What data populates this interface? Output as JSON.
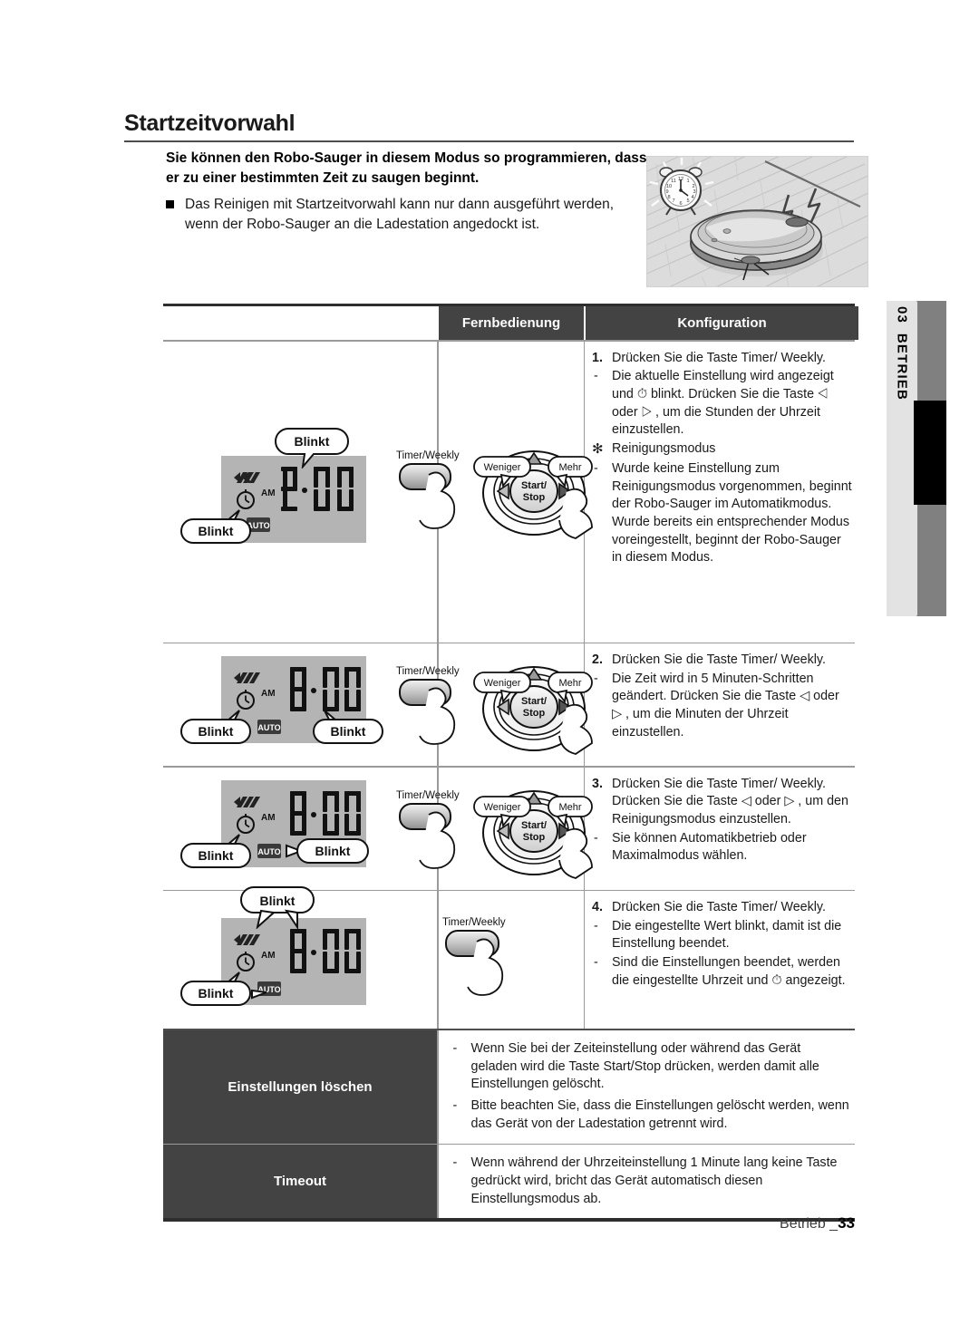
{
  "document": {
    "section_tab_number": "03",
    "section_tab_label": "BETRIEB",
    "heading": "Startzeitvorwahl",
    "footer_label": "Betrieb _",
    "footer_page": "33"
  },
  "intro": {
    "lead": "Sie können den Robo-Sauger in diesem Modus so programmieren, dass er zu einer bestimmten Zeit zu saugen beginnt.",
    "bullet": "Das Reinigen mit Startzeitvorwahl kann nur dann ausgeführt werden, wenn der Robo-Sauger an die Ladestation angedockt ist."
  },
  "hero_image": {
    "alt": "Robo-Sauger auf Holzboden mit Wecker",
    "clock_label": "12"
  },
  "table": {
    "headers": {
      "blank": "",
      "remote": "Fernbedienung",
      "config": "Konfiguration"
    },
    "rows": [
      {
        "display": {
          "time": "12:00",
          "meridiem": "AM",
          "auto_label": "AUTO",
          "callouts": [
            "Blinkt",
            "Blinkt"
          ]
        },
        "remote": {
          "timer_label": "Timer/Weekly",
          "less_label": "Weniger",
          "more_label": "Mehr",
          "center_label_1": "Start/",
          "center_label_2": "Stop",
          "show_dpad": true
        },
        "config": [
          {
            "marker": "1.",
            "text": "Drücken Sie die Taste Timer/ Weekly."
          },
          {
            "marker": "-",
            "text": "Die aktuelle Einstellung wird angezeigt und ⏱ blinkt. Drücken Sie die Taste ◁ oder ▷ , um die Stunden der Uhrzeit einzustellen."
          },
          {
            "marker": "✻",
            "text": "Reinigungsmodus"
          },
          {
            "marker": "-",
            "text": "Wurde keine Einstellung zum Reinigungsmodus vorgenommen, beginnt der Robo-Sauger im Automatikmodus. Wurde bereits ein entsprechender Modus voreingestellt, beginnt der Robo-Sauger in diesem Modus."
          }
        ]
      },
      {
        "display": {
          "time": "8:00",
          "meridiem": "AM",
          "auto_label": "AUTO",
          "callouts": [
            "Blinkt",
            "Blinkt"
          ]
        },
        "remote": {
          "timer_label": "Timer/Weekly",
          "less_label": "Weniger",
          "more_label": "Mehr",
          "center_label_1": "Start/",
          "center_label_2": "Stop",
          "show_dpad": true
        },
        "config": [
          {
            "marker": "2.",
            "text": "Drücken Sie die Taste Timer/ Weekly."
          },
          {
            "marker": "-",
            "text": "Die Zeit wird in 5 Minuten-Schritten geändert. Drücken Sie die Taste ◁ oder ▷ , um die Minuten der Uhrzeit einzustellen."
          }
        ]
      },
      {
        "display": {
          "time": "8:00",
          "meridiem": "AM",
          "auto_label": "AUTO",
          "callouts": [
            "Blinkt",
            "Blinkt"
          ]
        },
        "remote": {
          "timer_label": "Timer/Weekly",
          "less_label": "Weniger",
          "more_label": "Mehr",
          "center_label_1": "Start/",
          "center_label_2": "Stop",
          "show_dpad": true
        },
        "config": [
          {
            "marker": "3.",
            "text": "Drücken Sie die Taste Timer/ Weekly. Drücken Sie die Taste ◁ oder ▷ , um den Reinigungsmodus einzustellen."
          },
          {
            "marker": "-",
            "text": "Sie können Automatikbetrieb oder Maximalmodus wählen."
          }
        ]
      },
      {
        "display": {
          "time": "8:00",
          "meridiem": "AM",
          "auto_label": "AUTO",
          "callouts": [
            "Blinkt",
            "Blinkt"
          ]
        },
        "remote": {
          "timer_label": "Timer/Weekly",
          "show_dpad": false
        },
        "config": [
          {
            "marker": "4.",
            "text": "Drücken Sie die Taste Timer/ Weekly."
          },
          {
            "marker": "-",
            "text": "Die eingestellte Wert blinkt, damit ist die Einstellung beendet."
          },
          {
            "marker": "-",
            "text": "Sind die Einstellungen beendet, werden die eingestellte Uhrzeit und ⏱ angezeigt."
          }
        ]
      }
    ],
    "footer_rows": [
      {
        "label": "Einstellungen löschen",
        "items": [
          {
            "marker": "-",
            "text": "Wenn Sie bei der Zeiteinstellung oder während das Gerät geladen wird die Taste Start/Stop drücken, werden damit alle Einstellungen gelöscht."
          },
          {
            "marker": "-",
            "text": "Bitte beachten Sie, dass die Einstellungen gelöscht werden, wenn das Gerät von der Ladestation getrennt wird."
          }
        ]
      },
      {
        "label": "Timeout",
        "items": [
          {
            "marker": "-",
            "text": "Wenn während der Uhrzeiteinstellung 1 Minute lang keine Taste gedrückt wird, bricht das Gerät automatisch diesen Einstellungsmodus ab."
          }
        ]
      }
    ]
  },
  "colors": {
    "header_dark": "#434343",
    "lcd_bg": "#b4b4b4",
    "rule": "#9a9a9a",
    "tab_grey": "#808080"
  }
}
